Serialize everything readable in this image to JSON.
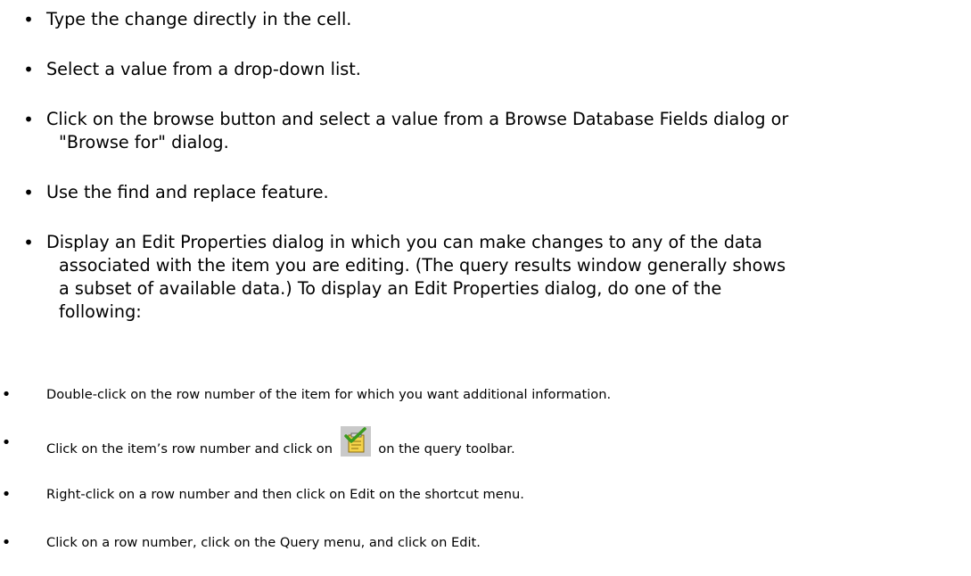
{
  "primary_items": [
    {
      "line1": "Type the change directly in the cell.",
      "line2": ""
    },
    {
      "line1": "Select a value from a drop-down list.",
      "line2": ""
    },
    {
      "line1": "Click on the browse button and select a value from a Browse Database Fields dialog or",
      "line2": "\"Browse for\" dialog."
    },
    {
      "line1": "Use the find and replace feature.",
      "line2": ""
    },
    {
      "line1": "Display an Edit Properties dialog in which you can make changes to any of the data",
      "line2": "associated with the item you are editing. (The query results window generally shows",
      "line3": "a subset of available data.) To display an Edit Properties dialog, do one of the",
      "line4": "following:"
    }
  ],
  "secondary_items": [
    {
      "text": "Double-click on the row number of the item for which you want additional information."
    },
    {
      "before": "Click on the item’s row number and click on",
      "icon": "edit-properties-icon",
      "after": "on the query toolbar."
    },
    {
      "text": "Right-click on a row number and then click on Edit on the shortcut menu."
    },
    {
      "text": "Click on a row number, click on the Query menu, and click on Edit."
    }
  ],
  "bullet_glyph": "•",
  "colors": {
    "text": "#000000",
    "background": "#ffffff",
    "icon_check": "#3a9a1e",
    "icon_paper": "#f4d24a"
  }
}
